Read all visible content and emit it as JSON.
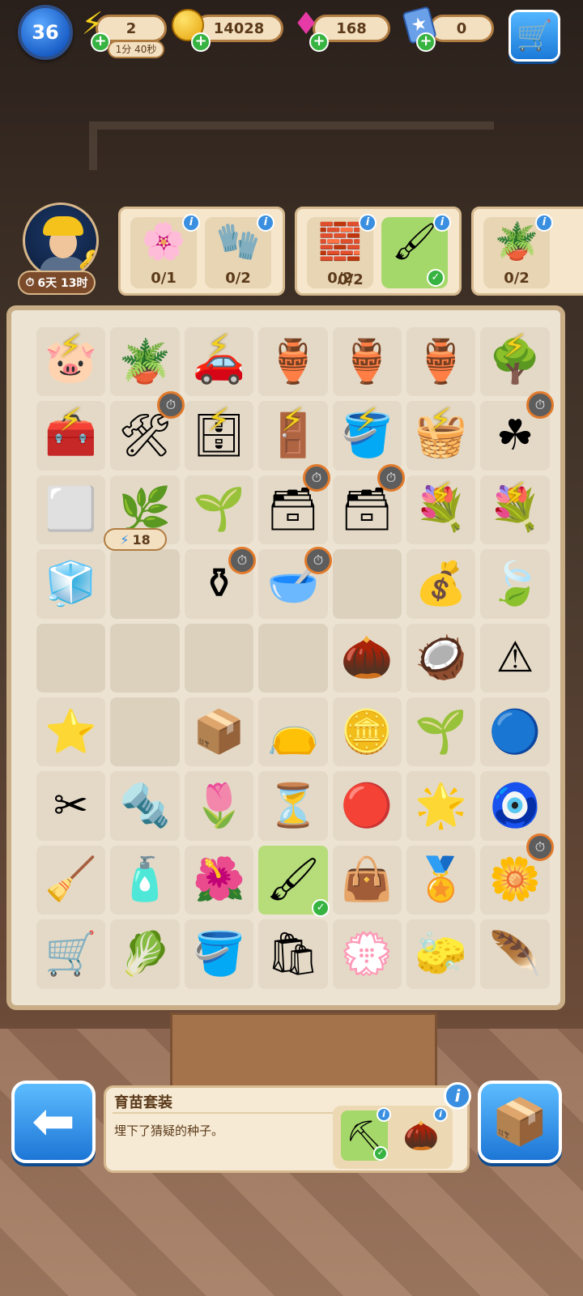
{
  "hud": {
    "level": "36",
    "energy": "2",
    "energy_timer": "1分 40秒",
    "coins": "14028",
    "gems": "168",
    "stars": "0",
    "energy_icon": "lightning-icon",
    "coin_icon": "coin-icon",
    "gem_icon": "gem-icon",
    "card_icon": "star-card-icon",
    "cart_icon": "cart-icon"
  },
  "customer": {
    "timer": "6天 13时"
  },
  "orders": [
    {
      "items": [
        {
          "name": "orchid-plant",
          "count": "0/1"
        },
        {
          "name": "gardening-gloves",
          "count": "0/2"
        }
      ]
    },
    {
      "items": [
        {
          "name": "stone-tiles",
          "count": "0/2"
        },
        {
          "name": "paint-roller",
          "count": "0/2",
          "done": true
        }
      ]
    },
    {
      "items": [
        {
          "name": "fern-plant",
          "count": "0/2"
        }
      ]
    }
  ],
  "board": {
    "generator_charges": "18"
  },
  "selected": {
    "title": "育苗套装",
    "description": "埋下了猜疑的种子。"
  },
  "colors": {
    "accent_blue": "#1d76d6",
    "energy_yellow": "#f4d21c",
    "panel_bg": "#f6ead4",
    "board_bg": "#ece3d3",
    "highlight_green": "#b6dd7a"
  }
}
